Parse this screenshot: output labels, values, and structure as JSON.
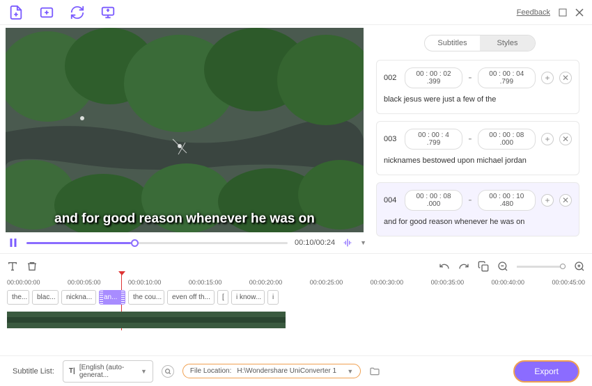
{
  "topbar": {
    "feedback": "Feedback"
  },
  "tabs": {
    "subtitles": "Subtitles",
    "styles": "Styles"
  },
  "player": {
    "caption": "and for good reason whenever he was on",
    "time": "00:10/00:24"
  },
  "subs": [
    {
      "num": "002",
      "start": "00 :  00 : 02 .399",
      "end": "00 :  00 : 04 .799",
      "text": "black jesus were just a few of the"
    },
    {
      "num": "003",
      "start": "00 :  00 : 4 .799",
      "end": "00 :  00 : 08 .000",
      "text": "nicknames bestowed upon michael jordan"
    },
    {
      "num": "004",
      "start": "00 :  00 : 08 .000",
      "end": "00 :  00 : 10 .480",
      "text": "and for good reason whenever he was on"
    }
  ],
  "ruler": [
    "00:00:00:00",
    "00:00:05:00",
    "00:00:10:00",
    "00:00:15:00",
    "00:00:20:00",
    "00:00:25:00",
    "00:00:30:00",
    "00:00:35:00",
    "00:00:40:00",
    "00:00:45:00"
  ],
  "clips": [
    "the...",
    "blac...",
    "nickna...",
    "an...",
    "the cou...",
    "even off th...",
    "[",
    "i know...",
    "i"
  ],
  "bottom": {
    "subtitle_list_label": "Subtitle List:",
    "subtitle_list_value": "[English (auto-generat...",
    "file_location_label": "File Location:",
    "file_location_value": "H:\\Wondershare UniConverter 1",
    "export": "Export"
  }
}
